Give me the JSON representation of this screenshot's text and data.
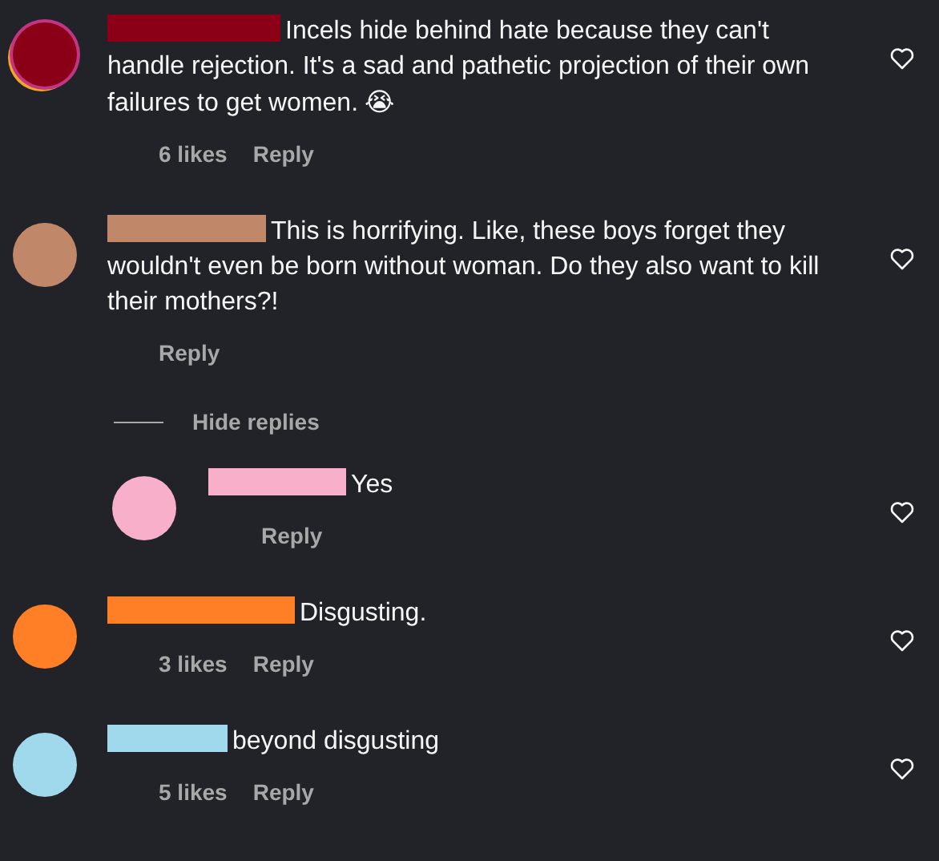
{
  "comments": [
    {
      "color": "#8b0016",
      "story_ring": true,
      "text": "Incels hide behind hate because they can't handle rejection. It's a sad and pathetic projection of their own failures to get women.",
      "emoji": "😭",
      "likes": "6 likes",
      "reply": "Reply",
      "liked": false
    },
    {
      "color": "#c08868",
      "story_ring": false,
      "text": "This is horrifying. Like, these boys forget they wouldn't even be born without woman. Do they also want to kill their mothers?!",
      "reply": "Reply",
      "liked": false,
      "toggle": "Hide replies",
      "replies": [
        {
          "color": "#f8afca",
          "story_ring": false,
          "text": "Yes",
          "reply": "Reply",
          "liked": false
        }
      ]
    },
    {
      "color": "#ff7f27",
      "story_ring": false,
      "text": "Disgusting.",
      "likes": "3 likes",
      "reply": "Reply",
      "liked": false
    },
    {
      "color": "#a0d8ec",
      "story_ring": false,
      "text": "beyond disgusting",
      "likes": "5 likes",
      "reply": "Reply",
      "liked": false
    }
  ]
}
